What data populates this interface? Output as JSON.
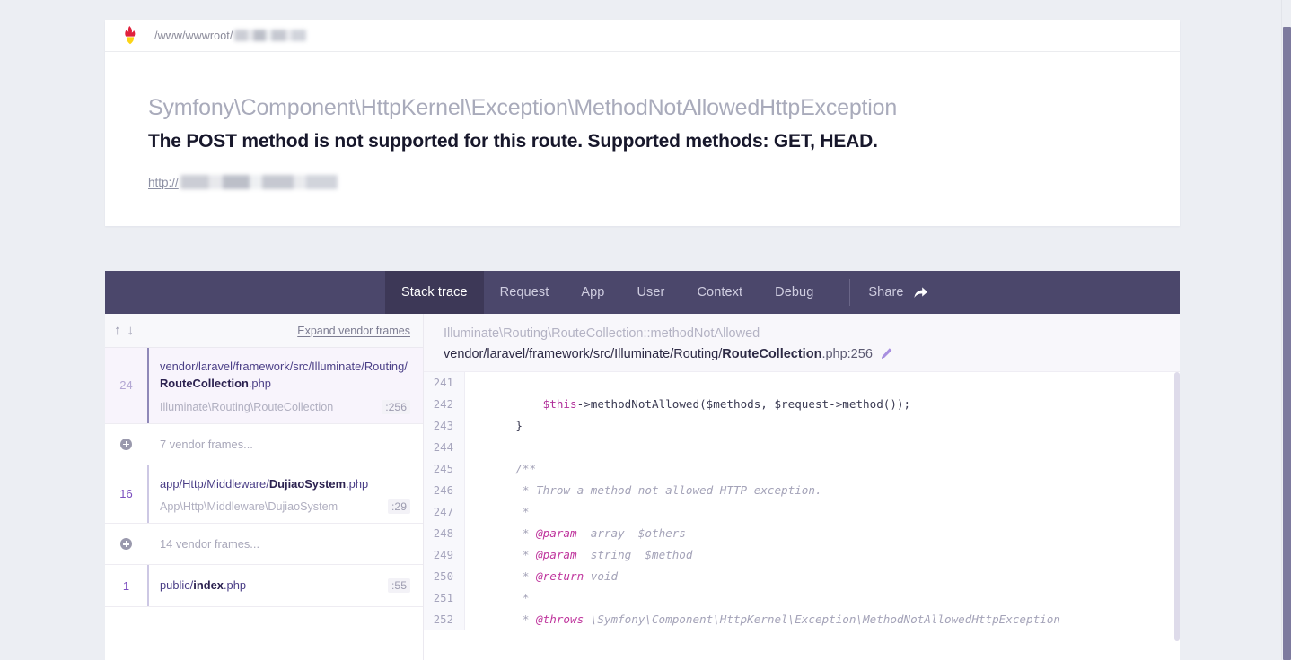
{
  "header": {
    "logo_icon": "ignition-flame-logo",
    "path_prefix": "/www/wwwroot/",
    "path_redacted": true
  },
  "exception": {
    "class": "Symfony\\Component\\HttpKernel\\Exception\\MethodNotAllowedHttpException",
    "message": "The POST method is not supported for this route. Supported methods: GET, HEAD.",
    "url_protocol": "http://",
    "url_redacted": true
  },
  "tabs": [
    {
      "label": "Stack trace",
      "active": true
    },
    {
      "label": "Request",
      "active": false
    },
    {
      "label": "App",
      "active": false
    },
    {
      "label": "User",
      "active": false
    },
    {
      "label": "Context",
      "active": false
    },
    {
      "label": "Debug",
      "active": false
    }
  ],
  "share": {
    "label": "Share",
    "icon": "share-arrow-icon"
  },
  "frames_toolbar": {
    "up_arrow": "↑",
    "down_arrow": "↓",
    "expand_label": "Expand vendor frames"
  },
  "frames": [
    {
      "type": "frame",
      "number": "24",
      "file_prefix": "vendor/laravel/framework/src/Illuminate/Routing/",
      "file_name": "RouteCollection",
      "file_ext": ".php",
      "class": "Illuminate\\Routing\\RouteCollection",
      "line": ":256",
      "active": true
    },
    {
      "type": "vendor",
      "label": "7 vendor frames...",
      "icon": "plus-circle-icon"
    },
    {
      "type": "frame",
      "number": "16",
      "file_prefix": "app/Http/Middleware/",
      "file_name": "DujiaoSystem",
      "file_ext": ".php",
      "class": "App\\Http\\Middleware\\DujiaoSystem",
      "line": ":29",
      "active": false
    },
    {
      "type": "vendor",
      "label": "14 vendor frames...",
      "icon": "plus-circle-icon"
    },
    {
      "type": "frame",
      "number": "1",
      "file_prefix": "public/",
      "file_name": "index",
      "file_ext": ".php",
      "class": "",
      "line": ":55",
      "active": false
    }
  ],
  "code_header": {
    "function": "Illuminate\\Routing\\RouteCollection::methodNotAllowed",
    "file_prefix": "vendor/laravel/framework/src/Illuminate/Routing/",
    "file_name": "RouteCollection",
    "file_tail": ".php:256",
    "edit_icon": "pencil-icon"
  },
  "code_lines": [
    {
      "n": "241",
      "segments": []
    },
    {
      "n": "242",
      "segments": [
        {
          "t": "        ",
          "c": "plain"
        },
        {
          "t": "$this",
          "c": "var"
        },
        {
          "t": "->methodNotAllowed($methods, $request->method());",
          "c": "plain"
        }
      ]
    },
    {
      "n": "243",
      "segments": [
        {
          "t": "    }",
          "c": "plain"
        }
      ]
    },
    {
      "n": "244",
      "segments": []
    },
    {
      "n": "245",
      "segments": [
        {
          "t": "    /**",
          "c": "com"
        }
      ]
    },
    {
      "n": "246",
      "segments": [
        {
          "t": "     * Throw a method not allowed HTTP exception.",
          "c": "com"
        }
      ]
    },
    {
      "n": "247",
      "segments": [
        {
          "t": "     *",
          "c": "com"
        }
      ]
    },
    {
      "n": "248",
      "segments": [
        {
          "t": "     * ",
          "c": "com"
        },
        {
          "t": "@param",
          "c": "tag"
        },
        {
          "t": "  array  $others",
          "c": "com"
        }
      ]
    },
    {
      "n": "249",
      "segments": [
        {
          "t": "     * ",
          "c": "com"
        },
        {
          "t": "@param",
          "c": "tag"
        },
        {
          "t": "  string  $method",
          "c": "com"
        }
      ]
    },
    {
      "n": "250",
      "segments": [
        {
          "t": "     * ",
          "c": "com"
        },
        {
          "t": "@return",
          "c": "tag"
        },
        {
          "t": " void",
          "c": "com"
        }
      ]
    },
    {
      "n": "251",
      "segments": [
        {
          "t": "     *",
          "c": "com"
        }
      ]
    },
    {
      "n": "252",
      "segments": [
        {
          "t": "     * ",
          "c": "com"
        },
        {
          "t": "@throws",
          "c": "tag"
        },
        {
          "t": " \\Symfony\\Component\\HttpKernel\\Exception\\MethodNotAllowedHttpException",
          "c": "com"
        }
      ]
    }
  ],
  "colors": {
    "page_bg": "#eceef3",
    "tabbar_bg": "#4b476b",
    "tab_active_bg": "#3d3857",
    "accent_purple": "#7c4fbf",
    "logo_red": "#e0213c",
    "logo_yellow": "#fcd416"
  }
}
